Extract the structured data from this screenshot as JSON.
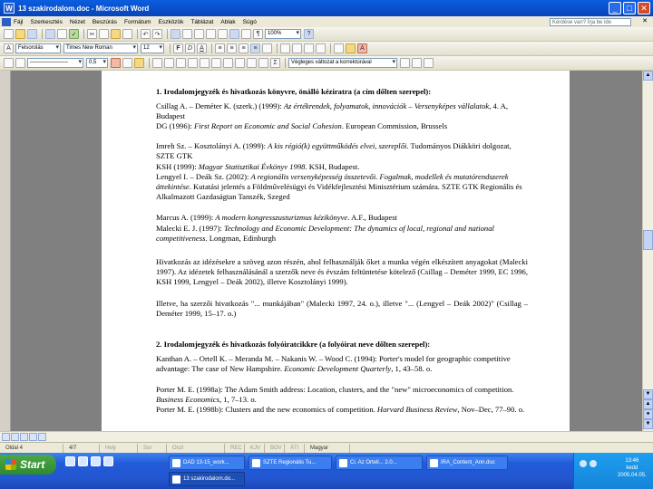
{
  "window": {
    "title": "13 szakirodalom.doc - Microsoft Word"
  },
  "menu": {
    "items": [
      "Fájl",
      "Szerkesztés",
      "Nézet",
      "Beszúrás",
      "Formátum",
      "Eszközök",
      "Táblázat",
      "Ablak",
      "Súgó"
    ],
    "help_placeholder": "Kérdése van? Írja be ide"
  },
  "toolbar": {
    "zoom": "100%",
    "style": "Felsorolás",
    "font": "Times New Roman",
    "size": "12",
    "bold": "F",
    "italic": "D",
    "underline": "A",
    "line_width": "0,5",
    "line_style": "———————",
    "review_label": "Végleges változat a korrektúrával"
  },
  "document": {
    "section1_title": "1.  Irodalomjegyzék és hivatkozás könyvre, önálló kéziratra (a cím dőlten szerepel):",
    "refs1": [
      {
        "pre": "Csillag A. – Deméter K. (szerk.) (1999): ",
        "it": "Az értékrendek, folyamatok, innovációk – Versenyképes vállalatok",
        "post": ", 4. A, Budapest"
      },
      {
        "pre": "DG (1996): ",
        "it": "First Report on Economic and Social Cohesion",
        "post": ". European Commission, Brussels"
      },
      {
        "pre": "Imreh Sz. – Kosztolányi A. (1999): ",
        "it": "A kis régió(k) együttműködés elvei, szereplői",
        "post": ". Tudományos Diákköri dolgozat, SZTE GTK"
      },
      {
        "pre": "KSH (1999): ",
        "it": "Magyar Statisztikai Évkönyv 1998",
        "post": ". KSH, Budapest."
      },
      {
        "pre": "Lengyel I. – Deák Sz. (2002): ",
        "it": "A regionális versenyképesség összetevői. Fogalmak, modellek és mutatórendszerek áttekintése",
        "post": ". Kutatási jelentés a Földművelésügyi és Vidékfejlesztési Minisztérium számára. SZTE GTK Regionális és Alkalmazott Gazdaságtan Tanszék, Szeged"
      },
      {
        "pre": "Marcus A. (1999): ",
        "it": "A modern kongresszusturizmus kézikönyve",
        "post": ". A.F., Budapest"
      },
      {
        "pre": "Malecki E. J. (1997): ",
        "it": "Technology and Economic Development: The dynamics of local, regional and national competitiveness",
        "post": ". Longman, Edinburgh"
      }
    ],
    "para1": "Hivatkozás az idézésekre a szöveg azon részén, ahol felhasználják őket a munka végén elkészített anyagokat (Malecki 1997). Az idézetek felhasználásánál a szerzők neve és évszám feltüntetése kötelező (Csillag – Deméter 1999, EC 1996, KSH 1999, Lengyel – Deák 2002), illetve Kosztolányi 1999).",
    "para2": "Illetve, ha szerzői hivatkozás \"... munkájában\" (Malecki 1997, 24. o.), illetve \"... (Lengyel – Deák 2002)\" (Csillag – Deméter 1999, 15–17. o.)",
    "section2_title": "2.  Irodalomjegyzék és hivatkozás folyóiratcikkre (a folyóirat neve dőlten szerepel):",
    "refs2": [
      {
        "pre": "Kanthan A. – Ortell K. – Meranda M. – Nakanis W. – Wood C. (1994): Porter's model for geographic competitive advantage: The case of New Hampshire. ",
        "it": "Economic Development Quarterly",
        "post": ", 1, 43–58. o."
      },
      {
        "pre": "Porter M. E. (1998a): The Adam Smith address: Location, clusters, and the \"new\" microeconomics of competition. ",
        "it": "Business Economics",
        "post": ", 1, 7–13. o."
      },
      {
        "pre": "Porter M. E. (1998b): Clusters and the new economics of competition. ",
        "it": "Harvard Business Review",
        "post": ", Nov–Dec, 77–90. o."
      }
    ]
  },
  "status": {
    "page": "Oldal 4",
    "section": "4/7",
    "position": "Hely",
    "line": "Sor",
    "column": "Oszl",
    "rec": "REC",
    "trk": "KJV",
    "ext": "BOV",
    "ovr": "ÁTI",
    "language": "Magyar"
  },
  "taskbar": {
    "start": "Start",
    "buttons": [
      "DAD 13-15_work...",
      "SZTE Regionális Tu...",
      "Ci. Az Ortell... 2.0...",
      "IRA_Content_Ann.doc",
      "13 szakirodalom.do..."
    ],
    "clock_time": "13:46",
    "clock_day": "kedd",
    "clock_date": "2005.04.05."
  }
}
